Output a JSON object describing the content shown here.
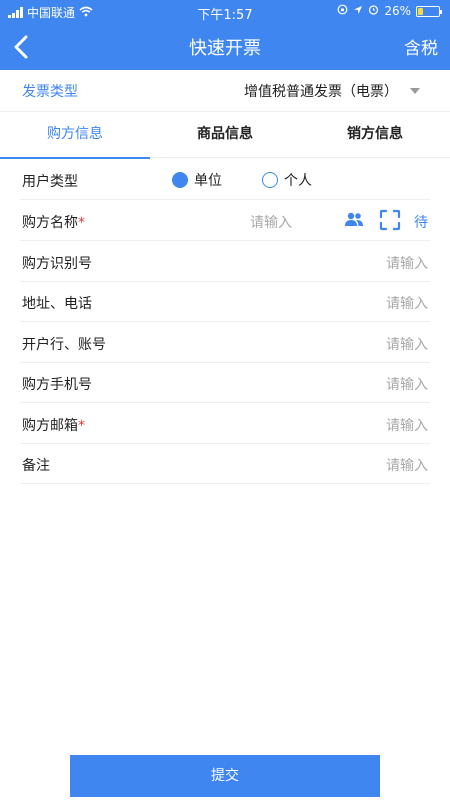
{
  "status": {
    "carrier": "中国联通",
    "time": "下午1:57",
    "battery": "26%",
    "battery_level": 0.26
  },
  "nav": {
    "title": "快速开票",
    "right_action": "含税",
    "back_icon": "chevron-left-icon"
  },
  "invoice_type": {
    "label": "发票类型",
    "value": "增值税普通发票（电票）"
  },
  "tabs": [
    {
      "label": "购方信息",
      "active": true
    },
    {
      "label": "商品信息",
      "active": false
    },
    {
      "label": "销方信息",
      "active": false
    }
  ],
  "form": {
    "user_type": {
      "label": "用户类型",
      "options": [
        "单位",
        "个人"
      ],
      "selected": "单位"
    },
    "buyer_name": {
      "label": "购方名称",
      "required": "*",
      "placeholder": "请输入",
      "extra": "待"
    },
    "buyer_tax_id": {
      "label": "购方识别号",
      "placeholder": "请输入"
    },
    "address_phone": {
      "label": "地址、电话",
      "placeholder": "请输入"
    },
    "bank_account": {
      "label": "开户行、账号",
      "placeholder": "请输入"
    },
    "buyer_mobile": {
      "label": "购方手机号",
      "placeholder": "请输入"
    },
    "buyer_email": {
      "label": "购方邮箱",
      "required": "*",
      "placeholder": "请输入"
    },
    "remark": {
      "label": "备注",
      "placeholder": "请输入"
    }
  },
  "submit_label": "提交",
  "colors": {
    "accent": "#3f86f0",
    "required": "#e23b3b"
  }
}
